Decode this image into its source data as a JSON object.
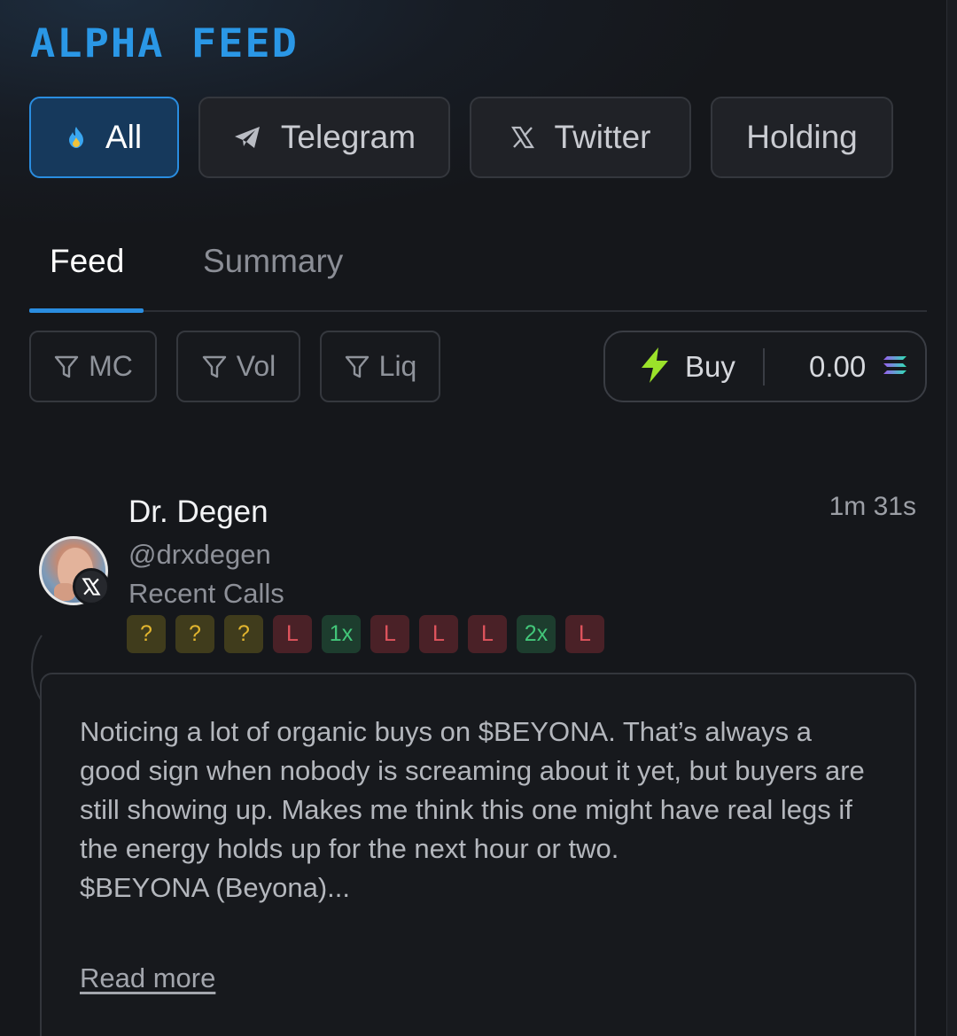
{
  "header": {
    "title": "ALPHA FEED"
  },
  "source_tabs": [
    {
      "label": "All",
      "icon": "flame-icon",
      "active": true
    },
    {
      "label": "Telegram",
      "icon": "telegram-icon",
      "active": false
    },
    {
      "label": "Twitter",
      "icon": "x-icon",
      "active": false
    },
    {
      "label": "Holding",
      "icon": "",
      "active": false
    }
  ],
  "view_tabs": [
    {
      "label": "Feed",
      "active": true
    },
    {
      "label": "Summary",
      "active": false
    }
  ],
  "filters": [
    {
      "label": "MC",
      "icon": "filter-icon"
    },
    {
      "label": "Vol",
      "icon": "filter-icon"
    },
    {
      "label": "Liq",
      "icon": "filter-icon"
    }
  ],
  "buy": {
    "label": "Buy",
    "amount": "0.00",
    "icon": "lightning-icon",
    "currency_icon": "solana-icon"
  },
  "post": {
    "author": "Dr. Degen",
    "handle": "@drxdegen",
    "recent_label": "Recent Calls",
    "time": "1m 31s",
    "platform_icon": "x-icon",
    "calls": [
      {
        "label": "?",
        "kind": "pending"
      },
      {
        "label": "?",
        "kind": "pending"
      },
      {
        "label": "?",
        "kind": "pending"
      },
      {
        "label": "L",
        "kind": "loss"
      },
      {
        "label": "1x",
        "kind": "win"
      },
      {
        "label": "L",
        "kind": "loss"
      },
      {
        "label": "L",
        "kind": "loss"
      },
      {
        "label": "L",
        "kind": "loss"
      },
      {
        "label": "2x",
        "kind": "win"
      },
      {
        "label": "L",
        "kind": "loss"
      }
    ],
    "body": "Noticing a lot of organic buys on $BEYONA. That’s always a good sign when nobody is screaming about it yet, but buyers are still showing up. Makes me think this one might have real legs if the energy holds up for the next hour or two.",
    "ticker_line": "$BEYONA (Beyona)...",
    "read_more": "Read more"
  },
  "colors": {
    "accent": "#2a97e6",
    "pending": "#e2b52e",
    "loss": "#e0545d",
    "win": "#43c77a",
    "bolt": "#9be22a"
  }
}
